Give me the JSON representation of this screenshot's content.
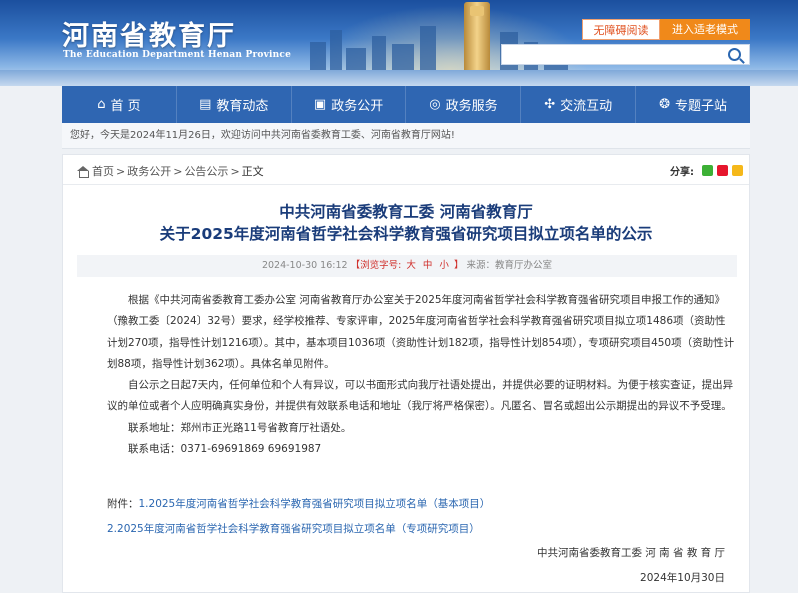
{
  "header": {
    "logo_cn": "河南省教育厅",
    "logo_en": "The Education Department Henan Province",
    "no_barrier_label": "无障碍阅读",
    "elder_mode_label": "进入适老模式",
    "search_placeholder": "",
    "colors": {
      "primary": "#2f66b2",
      "accent": "#f0891a"
    }
  },
  "nav": {
    "items": [
      {
        "label": "首 页",
        "icon": "home-icon",
        "glyph": "⌂"
      },
      {
        "label": "教育动态",
        "icon": "news-icon",
        "glyph": "▤"
      },
      {
        "label": "政务公开",
        "icon": "document-icon",
        "glyph": "▣"
      },
      {
        "label": "政务服务",
        "icon": "service-icon",
        "glyph": "◎"
      },
      {
        "label": "交流互动",
        "icon": "chat-icon",
        "glyph": "✣"
      },
      {
        "label": "专题子站",
        "icon": "topic-icon",
        "glyph": "❂"
      }
    ]
  },
  "welcome": "您好，今天是2024年11月26日，欢迎访问中共河南省委教育工委、河南省教育厅网站!",
  "breadcrumb": {
    "items": [
      "首页",
      "政务公开",
      "公告公示"
    ],
    "current": "正文",
    "share_label": "分享:"
  },
  "article": {
    "title_line1": "中共河南省委教育工委 河南省教育厅",
    "title_line2": "关于2025年度河南省哲学社会科学教育强省研究项目拟立项名单的公示",
    "date": "2024-10-30 16:12",
    "font_size_label": "【浏览字号:",
    "font_size_options": [
      "大",
      "中",
      "小"
    ],
    "font_size_close": "】",
    "source": "来源：教育厅办公室",
    "paragraphs": [
      "根据《中共河南省委教育工委办公室 河南省教育厅办公室关于2025年度河南省哲学社会科学教育强省研究项目申报工作的通知》（豫教工委〔2024〕32号）要求，经学校推荐、专家评审，2025年度河南省哲学社会科学教育强省研究项目拟立项1486项（资助性计划270项，指导性计划1216项）。其中，基本项目1036项（资助性计划182项，指导性计划854项），专项研究项目450项（资助性计划88项，指导性计划362项）。具体名单见附件。",
      "自公示之日起7天内，任何单位和个人有异议，可以书面形式向我厅社语处提出，并提供必要的证明材料。为便于核实查证，提出异议的单位或者个人应明确真实身份，并提供有效联系电话和地址（我厅将严格保密）。凡匿名、冒名或超出公示期提出的异议不予受理。",
      "联系地址：郑州市正光路11号省教育厅社语处。",
      "联系电话：0371-69691869 69691987"
    ],
    "attachment_label": "附件：",
    "attachments": [
      "1.2025年度河南省哲学社会科学教育强省研究项目拟立项名单（基本项目）",
      "2.2025年度河南省哲学社会科学教育强省研究项目拟立项名单（专项研究项目）"
    ],
    "signature": "中共河南省委教育工委 河 南 省 教 育 厅",
    "sign_date": "2024年10月30日"
  }
}
